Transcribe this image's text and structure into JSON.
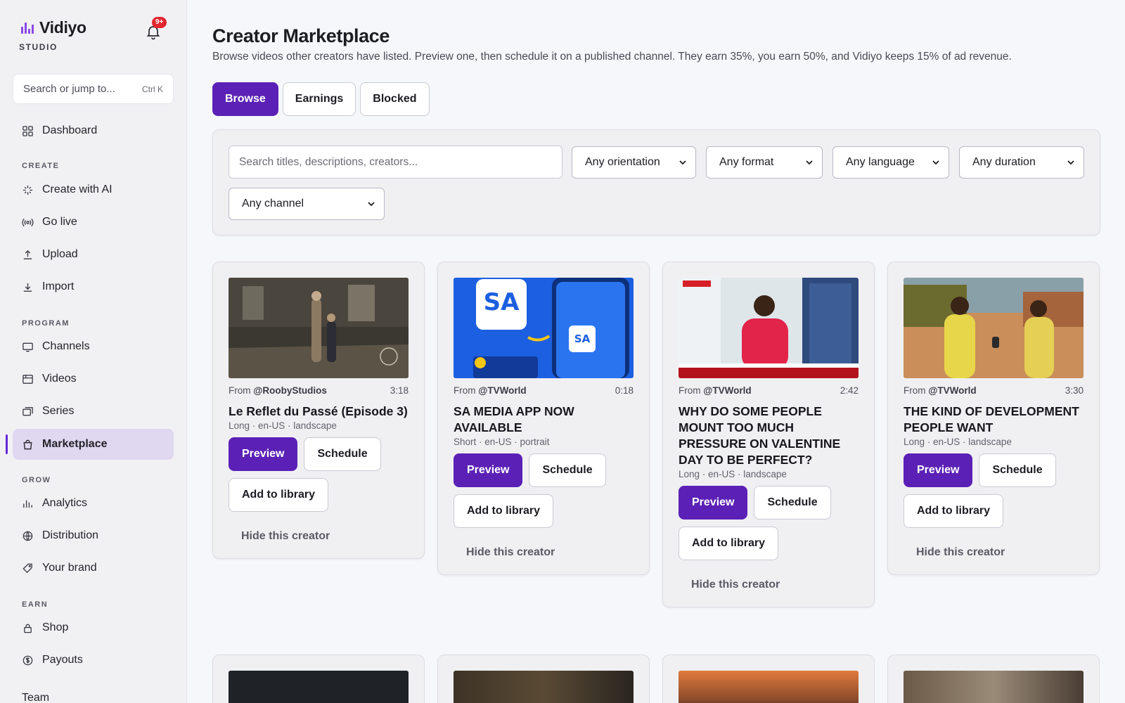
{
  "app": {
    "name": "Vidiyo",
    "sub": "STUDIO",
    "badge": "9+"
  },
  "jump": {
    "placeholder": "Search or jump to...",
    "shortcut": "Ctrl K"
  },
  "nav": {
    "dashboard": "Dashboard",
    "create_group": "CREATE",
    "create_ai": "Create with AI",
    "go_live": "Go live",
    "upload": "Upload",
    "import": "Import",
    "program_group": "PROGRAM",
    "channels": "Channels",
    "videos": "Videos",
    "series": "Series",
    "marketplace": "Marketplace",
    "grow_group": "GROW",
    "analytics": "Analytics",
    "distribution": "Distribution",
    "your_brand": "Your brand",
    "earn_group": "EARN",
    "shop": "Shop",
    "payouts": "Payouts",
    "team": "Team"
  },
  "page": {
    "title": "Creator Marketplace",
    "subtitle": "Browse videos other creators have listed. Preview one, then schedule it on a published channel. They earn 35%, you earn 50%, and Vidiyo keeps 15% of ad revenue."
  },
  "tabs": {
    "browse": "Browse",
    "earnings": "Earnings",
    "blocked": "Blocked"
  },
  "filters": {
    "search_placeholder": "Search titles, descriptions, creators...",
    "orientation": "Any orientation",
    "format": "Any format",
    "language": "Any language",
    "duration": "Any duration",
    "channel": "Any channel"
  },
  "card_actions": {
    "preview": "Preview",
    "schedule": "Schedule",
    "add": "Add to library",
    "hide": "Hide this creator"
  },
  "videos": [
    {
      "from": "From ",
      "creator": "@RoobyStudios",
      "duration": "3:18",
      "title": "Le Reflet du Passé (Episode 3)",
      "meta": "Long · en-US · landscape"
    },
    {
      "from": "From ",
      "creator": "@TVWorld",
      "duration": "0:18",
      "title": "SA MEDIA APP NOW AVAILABLE",
      "meta": "Short · en-US · portrait"
    },
    {
      "from": "From ",
      "creator": "@TVWorld",
      "duration": "2:42",
      "title": "WHY DO SOME PEOPLE MOUNT TOO MUCH PRESSURE ON VALENTINE DAY TO BE PERFECT?",
      "meta": "Long · en-US · landscape"
    },
    {
      "from": "From ",
      "creator": "@TVWorld",
      "duration": "3:30",
      "title": "THE KIND OF DEVELOPMENT PEOPLE WANT",
      "meta": "Long · en-US · landscape"
    }
  ],
  "colors": {
    "accent": "#5b21b6",
    "active_nav_bg": "#e0d7f0",
    "badge": "#e5262f"
  }
}
